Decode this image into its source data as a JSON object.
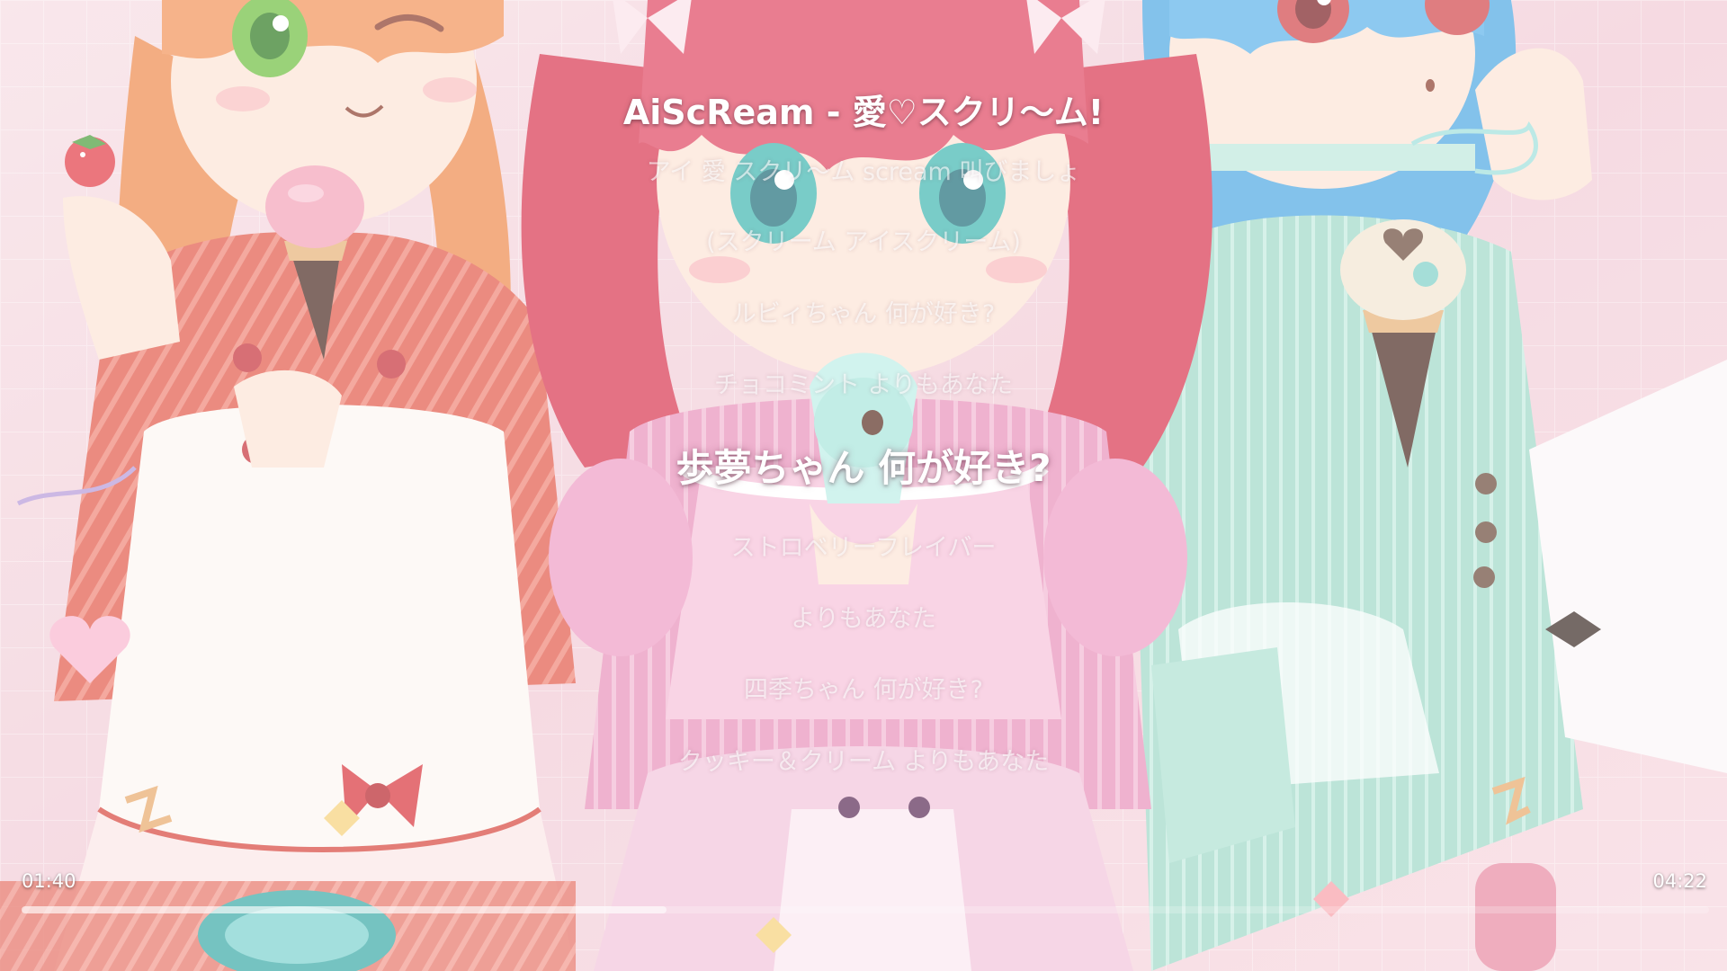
{
  "player": {
    "song_title": "AiScReam - 愛♡スクリ～ム!",
    "lyrics": [
      "アイ 愛 スクリ～ム scream 叫びましょ",
      "(スクリーム アイスクリーム)",
      "ルビィちゃん 何が好き?",
      "チョコミント よりもあなた",
      "歩夢ちゃん 何が好き?",
      "ストロベリーフレイバー",
      "よりもあなた",
      "四季ちゃん 何が好き?",
      "クッキー＆クリーム よりもあなた"
    ],
    "current_line_index": 4,
    "elapsed_time": "01:40",
    "total_time": "04:22",
    "progress_fraction": 0.382
  },
  "artwork": {
    "description_icon": "anime-artwork-background",
    "colors": {
      "bg_pink": "#f2c9d2",
      "orange_hair": "#f08a4b",
      "red_hair": "#d8354f",
      "blue_hair": "#4fa6e0",
      "mint_dress": "#9fd8c8",
      "pink_dress": "#e98fb8",
      "red_dress": "#e0574a"
    }
  }
}
